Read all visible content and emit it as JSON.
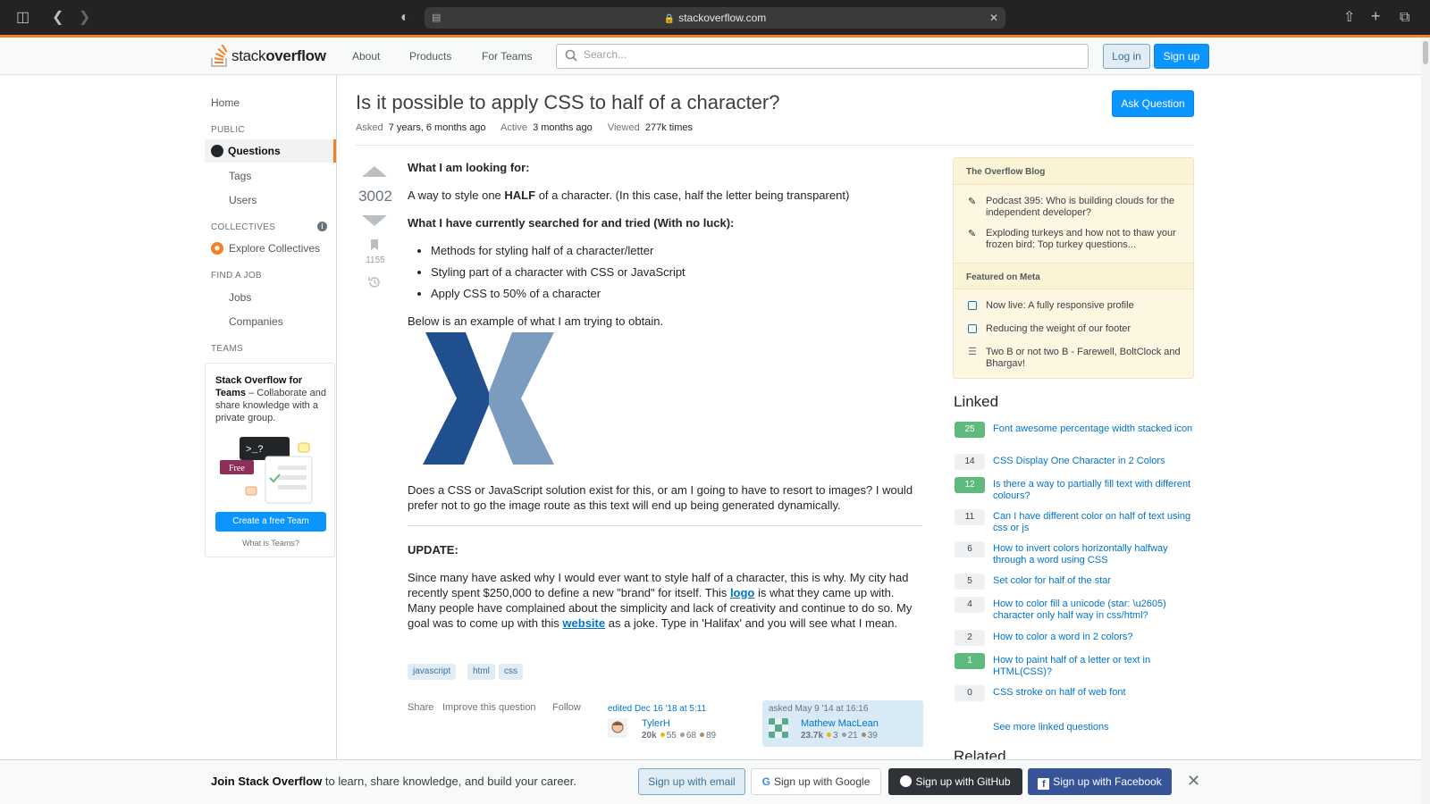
{
  "browser": {
    "url": "stackoverflow.com"
  },
  "header": {
    "logo_text_light": "stack",
    "logo_text_bold": "overflow",
    "nav": [
      "About",
      "Products",
      "For Teams"
    ],
    "search_placeholder": "Search...",
    "login_label": "Log in",
    "signup_label": "Sign up"
  },
  "left_nav": {
    "home": "Home",
    "public_heading": "PUBLIC",
    "questions": "Questions",
    "tags": "Tags",
    "users": "Users",
    "collectives_heading": "COLLECTIVES",
    "explore_collectives": "Explore Collectives",
    "find_job_heading": "FIND A JOB",
    "jobs": "Jobs",
    "companies": "Companies",
    "teams_heading": "TEAMS",
    "teams_promo_bold": "Stack Overflow for Teams",
    "teams_promo_rest": " – Collaborate and share knowledge with a private group.",
    "illo_prompt": ">_?",
    "illo_badge": "Free",
    "create_team": "Create a free Team",
    "what_is_teams": "What is Teams?"
  },
  "question": {
    "title": "Is it possible to apply CSS to half of a character?",
    "asked_label": "Asked",
    "asked_value": "7 years, 6 months ago",
    "active_label": "Active",
    "active_value": "3 months ago",
    "viewed_label": "Viewed",
    "viewed_value": "277k times",
    "ask_button": "Ask Question",
    "votes": "3002",
    "bookmarks": "1155",
    "looking_for": "What I am looking for:",
    "style_half_pre": "A way to style one ",
    "style_half_bold": "HALF",
    "style_half_post": " of a character. (In this case, half the letter being transparent)",
    "searched": "What I have currently searched for and tried (With no luck):",
    "tried": [
      "Methods for styling half of a character/letter",
      "Styling part of a character with CSS or JavaScript",
      "Apply CSS to 50% of a character"
    ],
    "example_intro": "Below is an example of what I am trying to obtain.",
    "solution_q": "Does a CSS or JavaScript solution exist for this, or am I going to have to resort to images? I would prefer not to go the image route as this text will end up being generated dynamically.",
    "update_heading": "UPDATE:",
    "update_p1": "Since many have asked why I would ever want to style half of a character, this is why. My city had recently spent $250,000 to define a new \"brand\" for itself. This ",
    "logo_link": "logo",
    "update_p2": " is what they came up with. Many people have complained about the simplicity and lack of creativity and continue to do so. My goal was to come up with this ",
    "website_link": "website",
    "update_p3": " as a joke. Type in 'Halifax' and you will see what I mean.",
    "tags": [
      "javascript",
      "html",
      "css"
    ],
    "menu": [
      "Share",
      "Improve this question",
      "Follow"
    ],
    "editor": {
      "time": "edited Dec 16 '18 at 5:11",
      "name": "TylerH",
      "rep": "20k",
      "gold": "55",
      "silver": "68",
      "bronze": "89"
    },
    "asker": {
      "time": "asked May 9 '14 at 16:16",
      "name": "Mathew MacLean",
      "rep": "23.7k",
      "gold": "3",
      "silver": "21",
      "bronze": "39"
    }
  },
  "sidebar": {
    "blog_heading": "The Overflow Blog",
    "blog_items": [
      "Podcast 395: Who is building clouds for the independent developer?",
      "Exploding turkeys and how not to thaw your frozen bird: Top turkey questions..."
    ],
    "meta_heading": "Featured on Meta",
    "meta_items": [
      "Now live: A fully responsive profile",
      "Reducing the weight of our footer",
      "Two B or not two B - Farewell, BoltClock and Bhargav!"
    ],
    "linked_heading": "Linked",
    "linked": [
      {
        "score": "25",
        "accepted": true,
        "title": "Font awesome percentage width stacked icon"
      },
      {
        "score": "14",
        "accepted": false,
        "title": "CSS Display One Character in 2 Colors"
      },
      {
        "score": "12",
        "accepted": true,
        "title": "Is there a way to partially fill text with different colours?"
      },
      {
        "score": "11",
        "accepted": false,
        "title": "Can I have different color on half of text using css or js"
      },
      {
        "score": "6",
        "accepted": false,
        "title": "How to invert colors horizontally halfway through a word using CSS"
      },
      {
        "score": "5",
        "accepted": false,
        "title": "Set color for half of the star"
      },
      {
        "score": "4",
        "accepted": false,
        "title": "How to color fill a unicode (star: \\u2605) character only half way in css/html?"
      },
      {
        "score": "2",
        "accepted": false,
        "title": "How to color a word in 2 colors?"
      },
      {
        "score": "1",
        "accepted": true,
        "title": "How to paint half of a letter or text in HTML(CSS)?"
      },
      {
        "score": "0",
        "accepted": false,
        "title": "CSS stroke on half of web font"
      }
    ],
    "see_more": "See more linked questions",
    "related_heading": "Related"
  },
  "banner": {
    "text_bold": "Join Stack Overflow",
    "text_rest": " to learn, share knowledge, and build your career.",
    "email": "Sign up with email",
    "google": "Sign up with Google",
    "github": "Sign up with GitHub",
    "facebook": "Sign up with Facebook"
  },
  "colors": {
    "accent": "#f48024",
    "link": "#0074cc",
    "primary_button": "#0a95ff",
    "accepted": "#5eba7d"
  }
}
